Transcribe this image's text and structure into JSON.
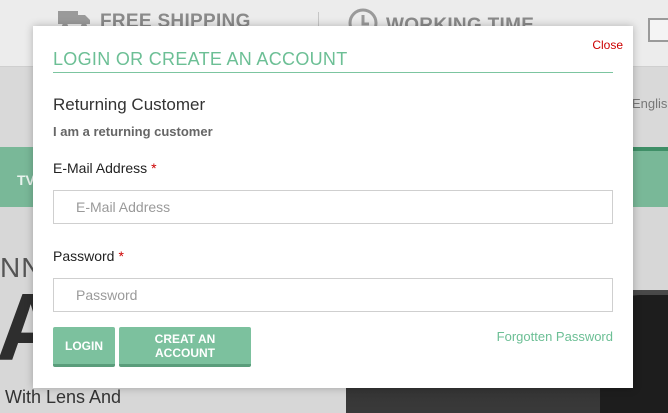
{
  "background": {
    "features": [
      {
        "icon": "truck-icon",
        "label": "FREE SHIPPING"
      },
      {
        "icon": "clock-icon",
        "label": "WORKING TIME"
      }
    ],
    "language": "English",
    "nav_partial": "TV",
    "hero_partial_word": "NNI",
    "hero_big_letter": "A",
    "hero_caption": "With Lens And"
  },
  "modal": {
    "close_label": "Close",
    "title": "LOGIN OR CREATE AN ACCOUNT",
    "section_heading": "Returning Customer",
    "section_subheading": "I am a returning customer",
    "email": {
      "label": "E-Mail Address",
      "required_mark": "*",
      "placeholder": "E-Mail Address",
      "value": ""
    },
    "password": {
      "label": "Password",
      "required_mark": "*",
      "placeholder": "Password",
      "value": ""
    },
    "login_button": "LOGIN",
    "create_account_button": "CREAT AN ACCOUNT",
    "forgotten_password_link": "Forgotten Password"
  },
  "colors": {
    "accent_green": "#6cbf95",
    "button_green": "#7cc19e",
    "required_red": "#cc0000",
    "nav_green": "#79b898"
  }
}
